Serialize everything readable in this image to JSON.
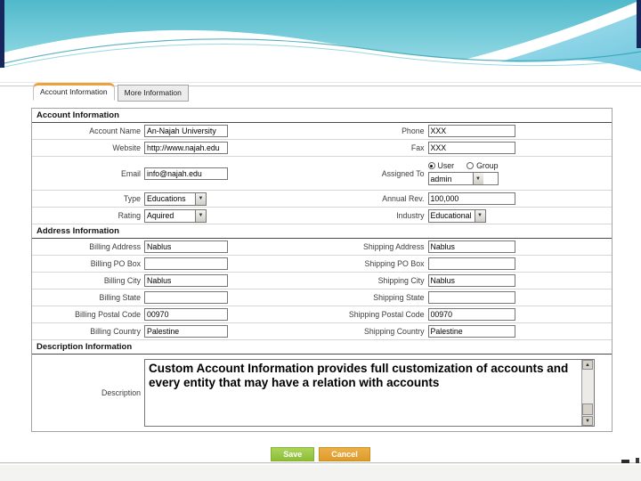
{
  "tabs": [
    {
      "label": "Account Information",
      "active": true
    },
    {
      "label": "More Information",
      "active": false
    }
  ],
  "form": {
    "account": {
      "title": "Account Information",
      "account_name": {
        "label": "Account Name",
        "value": "An-Najah University"
      },
      "phone": {
        "label": "Phone",
        "value": "XXX"
      },
      "website": {
        "label": "Website",
        "value": "http://www.najah.edu"
      },
      "fax": {
        "label": "Fax",
        "value": "XXX"
      },
      "email": {
        "label": "Email",
        "value": "info@najah.edu"
      },
      "assigned_to": {
        "label": "Assigned To",
        "radio_user": "User",
        "radio_group": "Group",
        "selected": "User",
        "dropdown_value": "admin"
      },
      "type": {
        "label": "Type",
        "value": "Educations"
      },
      "annual_rev": {
        "label": "Annual Rev.",
        "value": "100,000"
      },
      "rating": {
        "label": "Rating",
        "value": "Aquired"
      },
      "industry": {
        "label": "Industry",
        "value": "Educational"
      }
    },
    "address": {
      "title": "Address Information",
      "billing_address": {
        "label": "Billing Address",
        "value": "Nablus"
      },
      "shipping_address": {
        "label": "Shipping Address",
        "value": "Nablus"
      },
      "billing_po_box": {
        "label": "Billing PO Box",
        "value": ""
      },
      "shipping_po_box": {
        "label": "Shipping PO Box",
        "value": ""
      },
      "billing_city": {
        "label": "Billing City",
        "value": "Nablus"
      },
      "shipping_city": {
        "label": "Shipping City",
        "value": "Nablus"
      },
      "billing_state": {
        "label": "Billing State",
        "value": ""
      },
      "shipping_state": {
        "label": "Shipping State",
        "value": ""
      },
      "billing_postal_code": {
        "label": "Billing Postal Code",
        "value": "00970"
      },
      "shipping_postal_code": {
        "label": "Shipping Postal Code",
        "value": "00970"
      },
      "billing_country": {
        "label": "Billing Country",
        "value": "Palestine"
      },
      "shipping_country": {
        "label": "Shipping Country",
        "value": "Palestine"
      }
    },
    "description": {
      "title": "Description Information",
      "label": "Description",
      "text": "Custom Account Information provides full customization of accounts and every entity that may have a relation with accounts"
    }
  },
  "buttons": {
    "save": "Save",
    "cancel": "Cancel"
  },
  "icons": {
    "dropdown_arrow": "▼",
    "scroll_up": "▲",
    "scroll_down": "▼"
  },
  "colors": {
    "tab_accent_orange": "#e8a33d",
    "save_green": "#8fc142",
    "cancel_orange": "#e2a33c",
    "banner_teal_top": "#4fb9cb",
    "banner_teal_bottom": "#aae4ec",
    "banner_navy_edge": "#17265c"
  }
}
